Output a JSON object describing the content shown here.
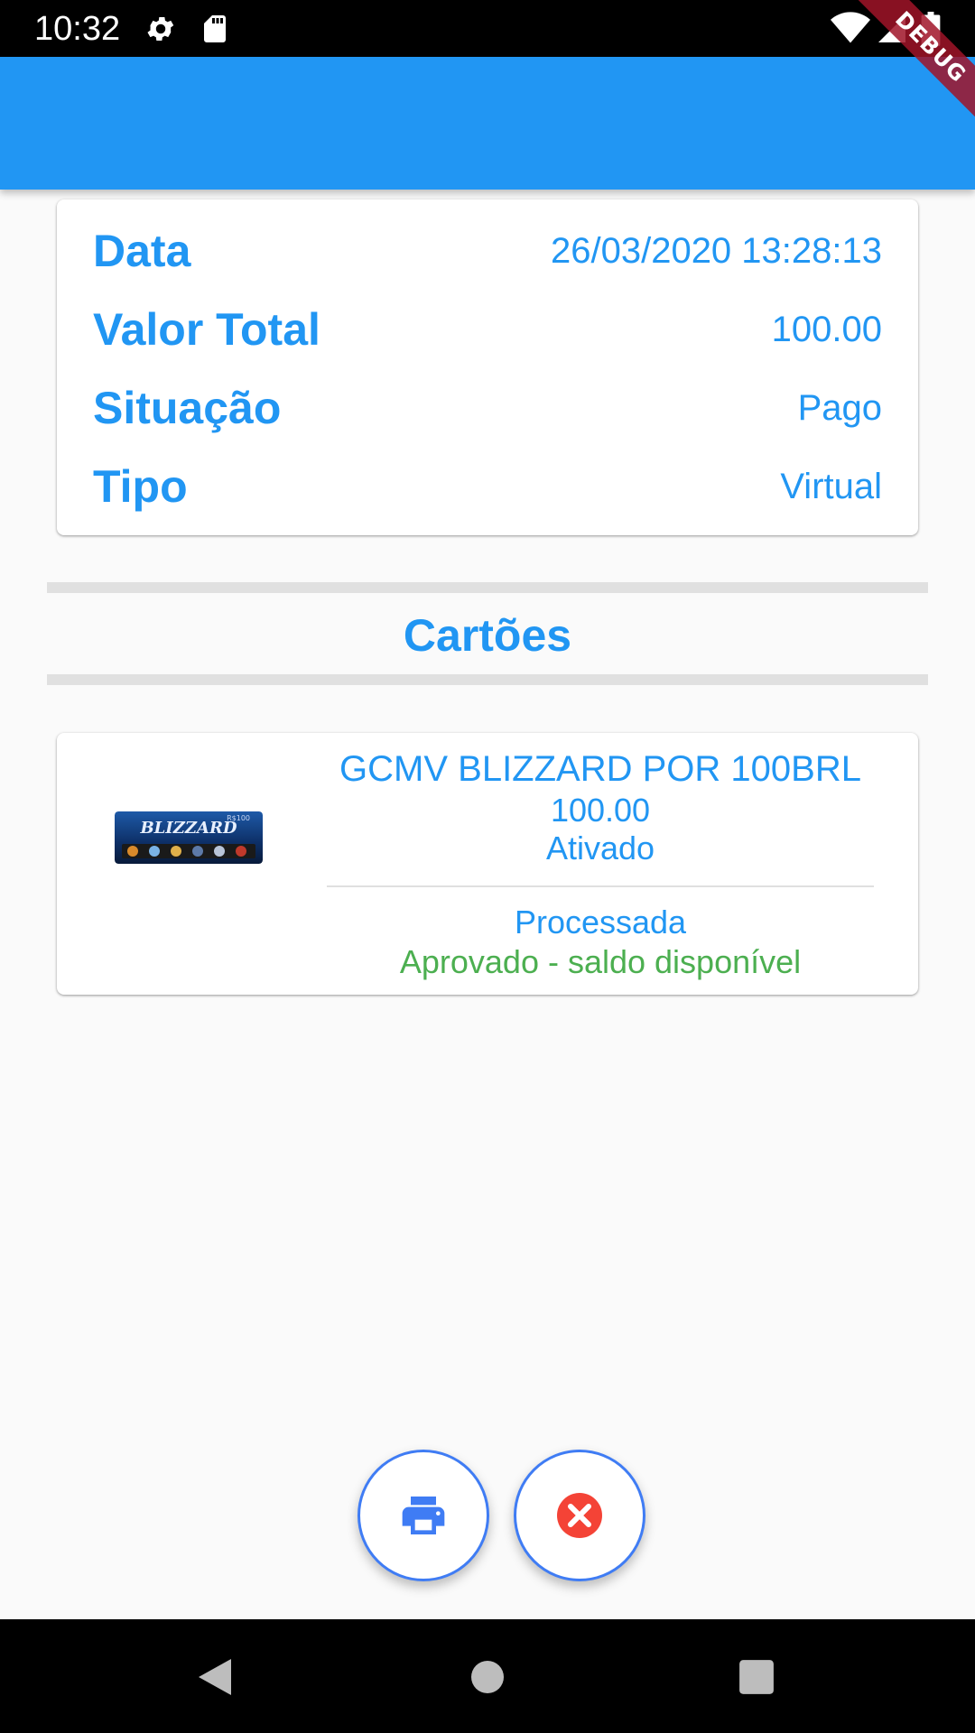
{
  "status_bar": {
    "time": "10:32",
    "icons": [
      "gear-icon",
      "sd-card-icon",
      "wifi-icon",
      "signal-icon",
      "battery-icon"
    ]
  },
  "debug_banner": "DEBUG",
  "app_bar": {
    "color": "#2196f3"
  },
  "order": {
    "rows": [
      {
        "label": "Data",
        "value": "26/03/2020 13:28:13"
      },
      {
        "label": "Valor Total",
        "value": "100.00"
      },
      {
        "label": "Situação",
        "value": "Pago"
      },
      {
        "label": "Tipo",
        "value": "Virtual"
      }
    ]
  },
  "cards_section": {
    "title": "Cartões",
    "items": [
      {
        "name": "GCMV BLIZZARD POR 100BRL",
        "value": "100.00",
        "status": "Ativado",
        "process_status": "Processada",
        "result": "Aprovado - saldo disponível",
        "thumbnail": {
          "brand": "BLIZZARD",
          "tag": "R$100"
        }
      }
    ]
  },
  "actions": {
    "print_icon": "print-icon",
    "cancel_icon": "cancel-icon"
  },
  "nav": {
    "icons": [
      "back-icon",
      "home-icon",
      "recents-icon"
    ]
  },
  "colors": {
    "primary": "#2196f3",
    "success": "#4caf50",
    "danger": "#f44336"
  }
}
